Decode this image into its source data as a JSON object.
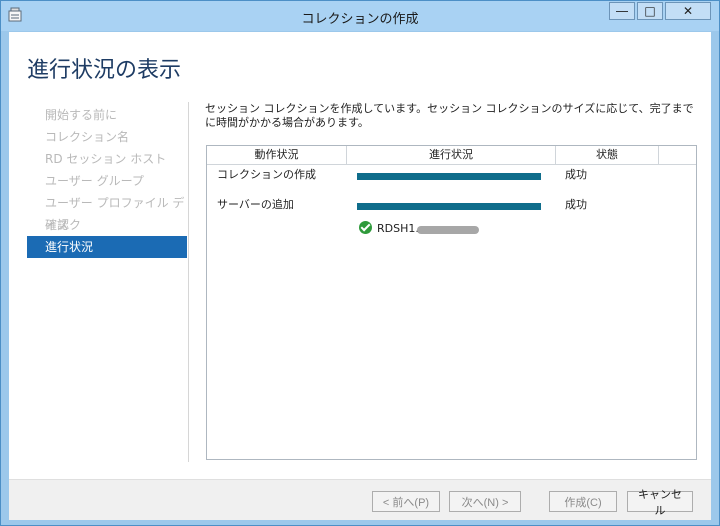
{
  "window": {
    "title": "コレクションの作成"
  },
  "titlebar_buttons": {
    "minimize": "―",
    "maximize": "□",
    "close": "✕"
  },
  "page": {
    "header": "進行状況の表示",
    "description": "セッション コレクションを作成しています。セッション コレクションのサイズに応じて、完了までに時間がかかる場合があります。"
  },
  "nav": {
    "items": [
      {
        "label": "開始する前に",
        "active": false
      },
      {
        "label": "コレクション名",
        "active": false
      },
      {
        "label": "RD セッション ホスト",
        "active": false
      },
      {
        "label": "ユーザー グループ",
        "active": false
      },
      {
        "label": "ユーザー プロファイル ディスク",
        "active": false
      },
      {
        "label": "確認",
        "active": false
      },
      {
        "label": "進行状況",
        "active": true
      }
    ]
  },
  "table": {
    "headers": [
      "動作状況",
      "進行状況",
      "状態"
    ],
    "rows": [
      {
        "task": "コレクションの作成",
        "progress": 1.0,
        "status": "成功"
      },
      {
        "task": "サーバーの追加",
        "progress": 1.0,
        "status": "成功"
      }
    ],
    "server": {
      "name": "RDSH1.",
      "status_icon": "check-icon"
    }
  },
  "footer": {
    "back": "< 前へ(P)",
    "next": "次へ(N) >",
    "create": "作成(C)",
    "cancel": "キャンセル"
  },
  "colors": {
    "accent": "#1b6bb4",
    "progress": "#0f6d8b",
    "success": "#2f9a3b"
  }
}
